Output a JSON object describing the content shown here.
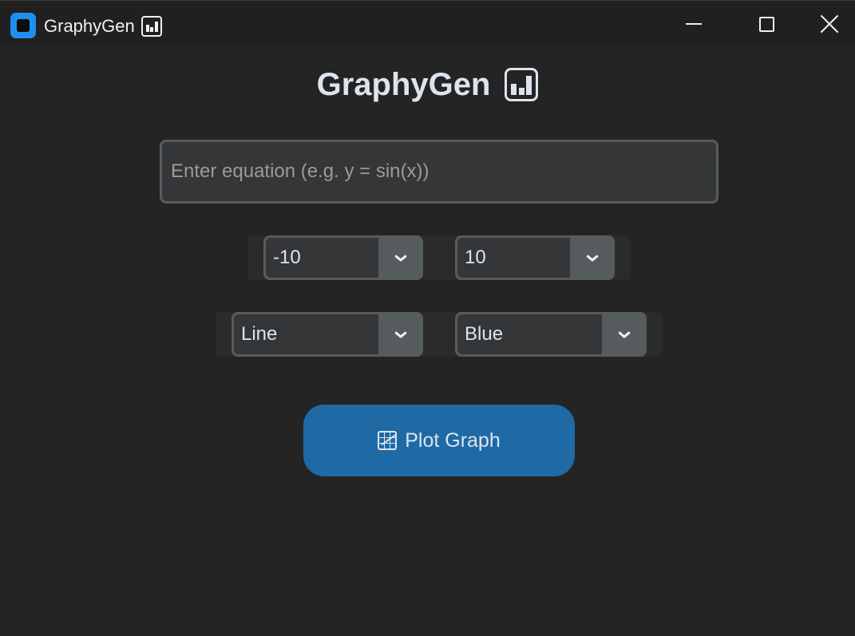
{
  "window": {
    "title": "GraphyGen",
    "title_icon": "bar-chart-emoji",
    "controls": [
      "minimize",
      "maximize",
      "close"
    ]
  },
  "header": {
    "title": "GraphyGen",
    "icon": "bar-chart-emoji"
  },
  "equation": {
    "placeholder": "Enter equation (e.g. y = sin(x))",
    "value": ""
  },
  "range": {
    "x_min": "-10",
    "x_max": "10"
  },
  "style": {
    "plot_type": "Line",
    "color": "Blue"
  },
  "plot_button": {
    "label": "Plot Graph",
    "icon": "chart-increasing-emoji"
  },
  "colors": {
    "background": "#242424",
    "titlebar": "#202020",
    "accent": "#1f6aa5",
    "app_icon": "#1f8ef1",
    "text": "#dce4ee"
  }
}
